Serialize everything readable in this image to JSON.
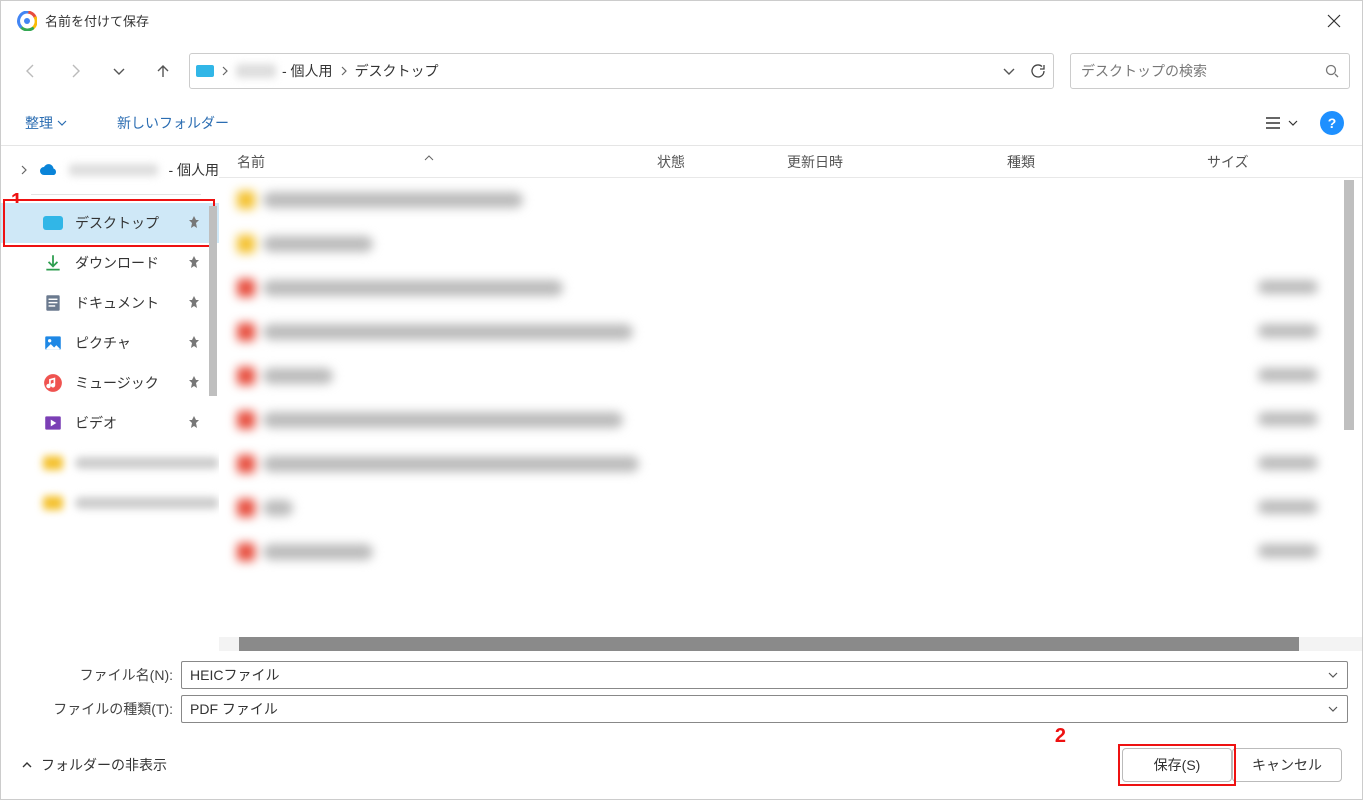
{
  "window": {
    "title": "名前を付けて保存"
  },
  "nav": {
    "breadcrumb": {
      "user_suffix": "- 個人用",
      "current": "デスクトップ"
    },
    "search_placeholder": "デスクトップの検索"
  },
  "toolbar": {
    "organize": "整理",
    "new_folder": "新しいフォルダー"
  },
  "tree": {
    "root_suffix": "- 個人用",
    "desktop": "デスクトップ",
    "downloads": "ダウンロード",
    "documents": "ドキュメント",
    "pictures": "ピクチャ",
    "music": "ミュージック",
    "videos": "ビデオ"
  },
  "columns": {
    "name": "名前",
    "state": "状態",
    "date": "更新日時",
    "type": "種類",
    "size": "サイズ"
  },
  "form": {
    "filename_label": "ファイル名(N):",
    "filename_value": "HEICファイル",
    "filetype_label": "ファイルの種類(T):",
    "filetype_value": "PDF ファイル"
  },
  "footer": {
    "hide_folders": "フォルダーの非表示",
    "save": "保存(S)",
    "cancel": "キャンセル"
  },
  "annotations": {
    "one": "1",
    "two": "2"
  }
}
